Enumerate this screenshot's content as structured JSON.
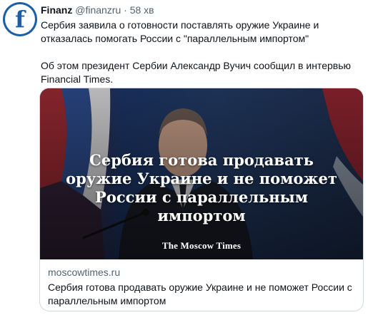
{
  "tweet": {
    "avatar_icon": "finanz-f-logo",
    "author_name": "Finanz",
    "handle": "@finanzru",
    "separator": "·",
    "time": "58 хв",
    "text_para1": "Сербия заявила о готовности поставлять оружие Украине и отказалась помогать России с \"параллельным импортом\"",
    "text_para2": "Об этом президент Сербии Александр Вучич сообщил в интервью Financial Times."
  },
  "card": {
    "headline": "Сербия готова продавать оружие Украине и не поможет России с параллельным импортом",
    "logo": "The Moscow Times",
    "domain": "moscowtimes.ru",
    "title": "Сербия готова продавать оружие Украине и не поможет России с параллельным импортом"
  },
  "colors": {
    "avatar_blue": "#1b5fa8",
    "secondary_text": "#536471",
    "card_border": "#cfd9de"
  }
}
